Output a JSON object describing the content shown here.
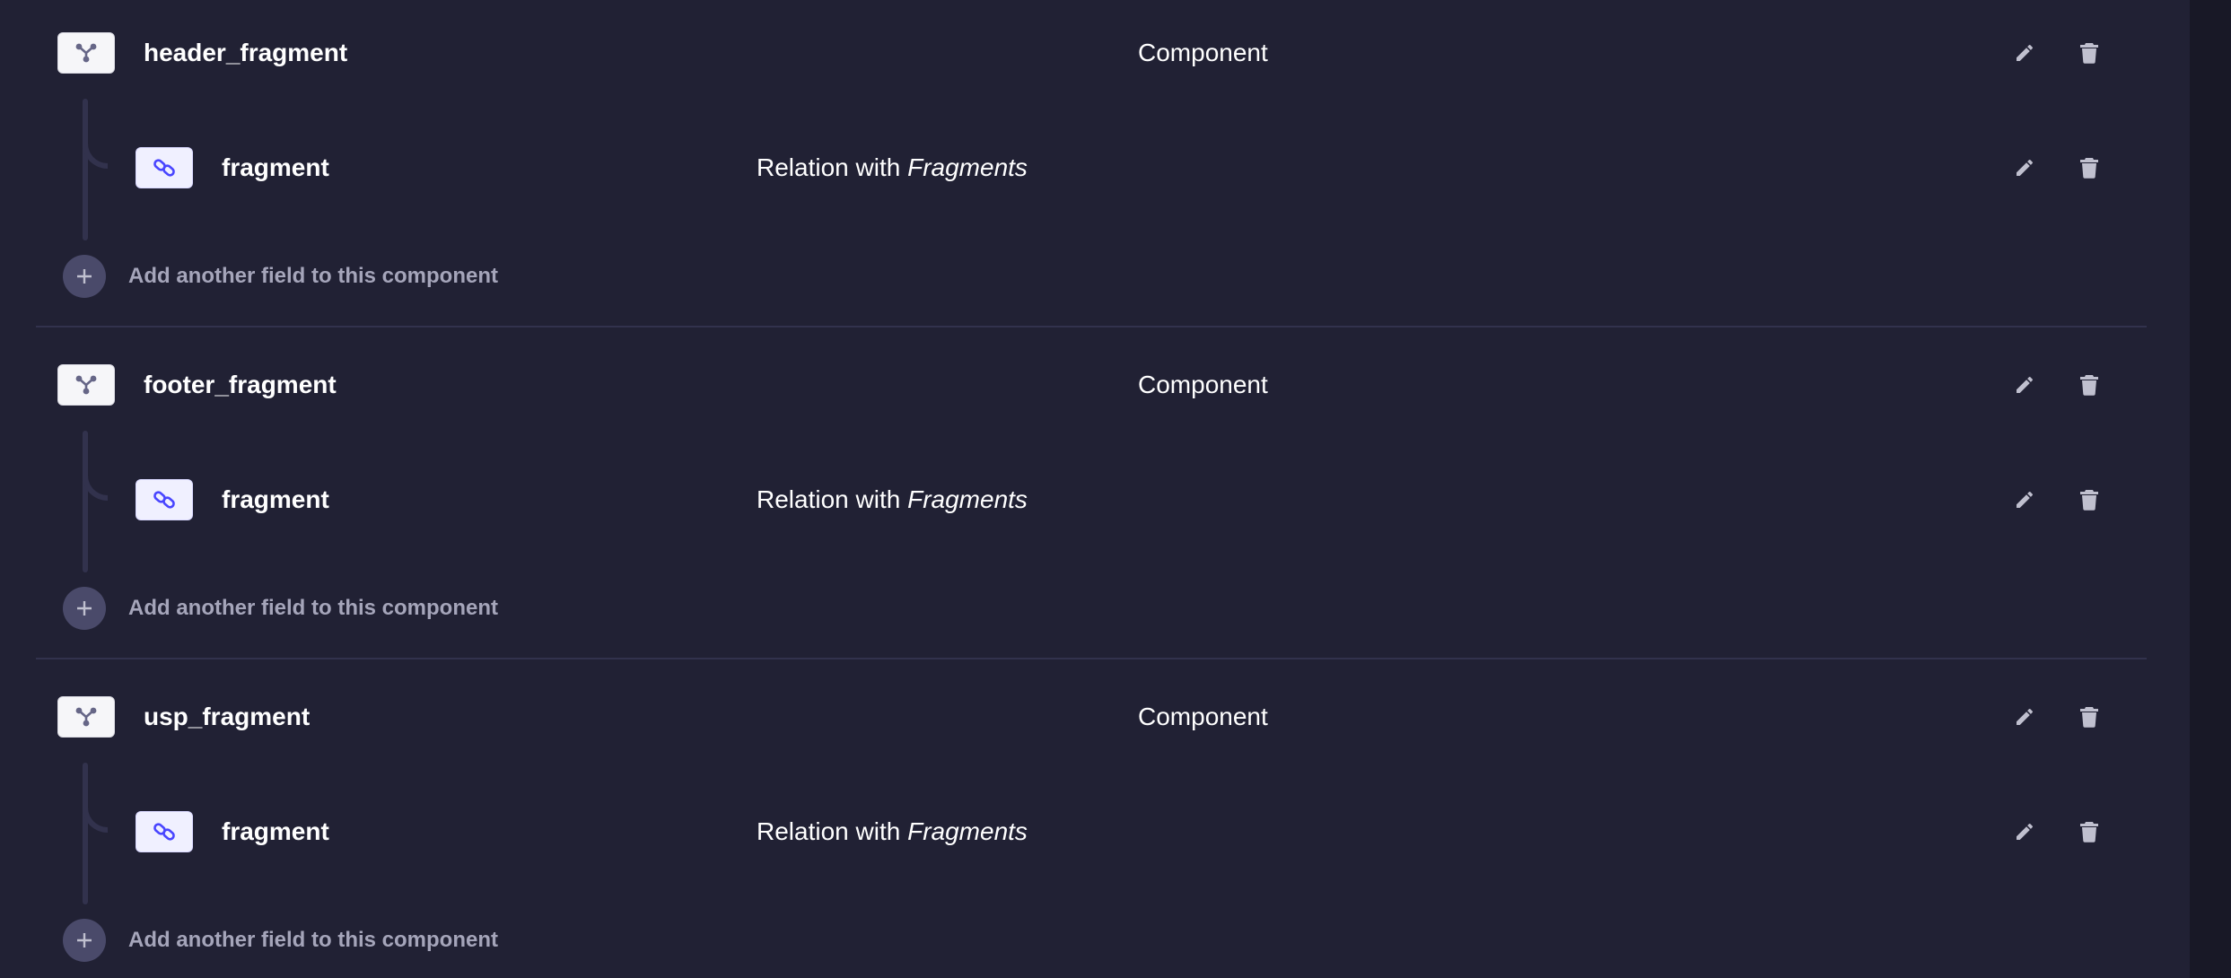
{
  "groups": [
    {
      "component": {
        "name": "header_fragment",
        "type": "Component"
      },
      "fields": [
        {
          "name": "fragment",
          "type_prefix": "Relation with",
          "type_target": "Fragments"
        }
      ],
      "add_label": "Add another field to this component"
    },
    {
      "component": {
        "name": "footer_fragment",
        "type": "Component"
      },
      "fields": [
        {
          "name": "fragment",
          "type_prefix": "Relation with",
          "type_target": "Fragments"
        }
      ],
      "add_label": "Add another field to this component"
    },
    {
      "component": {
        "name": "usp_fragment",
        "type": "Component"
      },
      "fields": [
        {
          "name": "fragment",
          "type_prefix": "Relation with",
          "type_target": "Fragments"
        }
      ],
      "add_label": "Add another field to this component"
    }
  ],
  "icons": {
    "component": "component-icon",
    "relation": "relation-icon",
    "edit": "pencil-icon",
    "delete": "trash-icon",
    "add": "plus-icon"
  },
  "colors": {
    "background": "#212134",
    "text": "#ffffff",
    "muted_text": "#a5a5ba",
    "relation_accent": "#4945ff"
  }
}
